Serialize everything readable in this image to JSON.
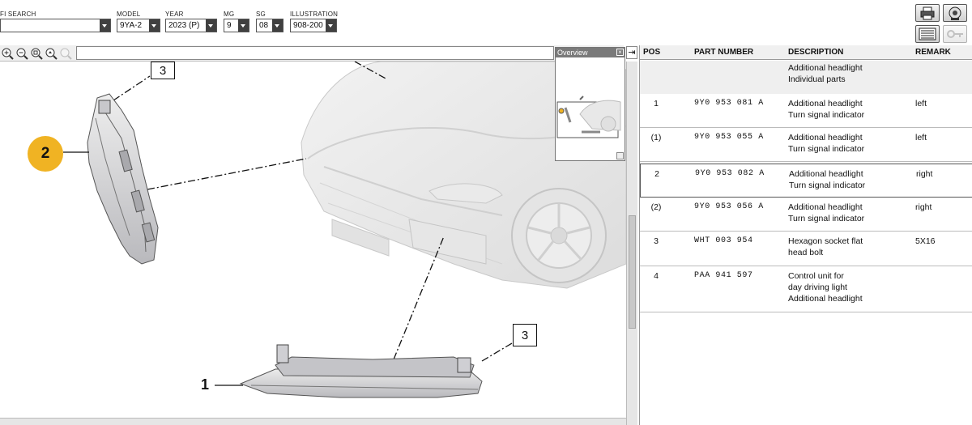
{
  "filters": [
    {
      "label": "FI SEARCH",
      "value": ""
    },
    {
      "label": "MODEL",
      "value": "9YA-2"
    },
    {
      "label": "YEAR",
      "value": "2023 (P)"
    },
    {
      "label": "MG",
      "value": "9"
    },
    {
      "label": "SG",
      "value": "08"
    },
    {
      "label": "ILLUSTRATION",
      "value": "908-200"
    }
  ],
  "toolbar_icons": {
    "print": "printer-icon",
    "assistant": "headset-icon",
    "list": "list-icon",
    "key": "key-icon"
  },
  "zoom_icons": [
    "zoom-in-icon",
    "zoom-out-icon",
    "zoom-fit-icon",
    "zoom-hand-icon",
    "zoom-reset-icon"
  ],
  "overview": {
    "title": "Overview",
    "close_glyph": "×"
  },
  "callouts": {
    "top_bolt": "3",
    "left_headlight": "2",
    "lower_bolt": "3",
    "lower_headlight": "1"
  },
  "table": {
    "headers": {
      "pos": "POS",
      "part_number": "PART NUMBER",
      "description": "DESCRIPTION",
      "remark": "REMARK"
    },
    "group": {
      "line1": "Additional headlight",
      "line2": "Individual parts"
    },
    "rows": [
      {
        "pos": "1",
        "part_number": "9Y0 953 081 A",
        "desc1": "Additional headlight",
        "desc2": "Turn signal indicator",
        "desc3": "",
        "remark": "left"
      },
      {
        "pos": "(1)",
        "part_number": "9Y0 953 055 A",
        "desc1": "Additional headlight",
        "desc2": "Turn signal indicator",
        "desc3": "",
        "remark": "left"
      },
      {
        "pos": "2",
        "part_number": "9Y0 953 082 A",
        "desc1": "Additional headlight",
        "desc2": "Turn signal indicator",
        "desc3": "",
        "remark": "right"
      },
      {
        "pos": "(2)",
        "part_number": "9Y0 953 056 A",
        "desc1": "Additional headlight",
        "desc2": "Turn signal indicator",
        "desc3": "",
        "remark": "right"
      },
      {
        "pos": "3",
        "part_number": "WHT 003 954",
        "desc1": "Hexagon socket flat",
        "desc2": "head bolt",
        "desc3": "",
        "remark": "5X16"
      },
      {
        "pos": "4",
        "part_number": "PAA 941 597",
        "desc1": "Control unit for",
        "desc2": "day driving light",
        "desc3": "Additional headlight",
        "remark": ""
      }
    ]
  },
  "colors": {
    "highlight_callout": "#f0b323",
    "scroll": "#c8c8c8"
  }
}
